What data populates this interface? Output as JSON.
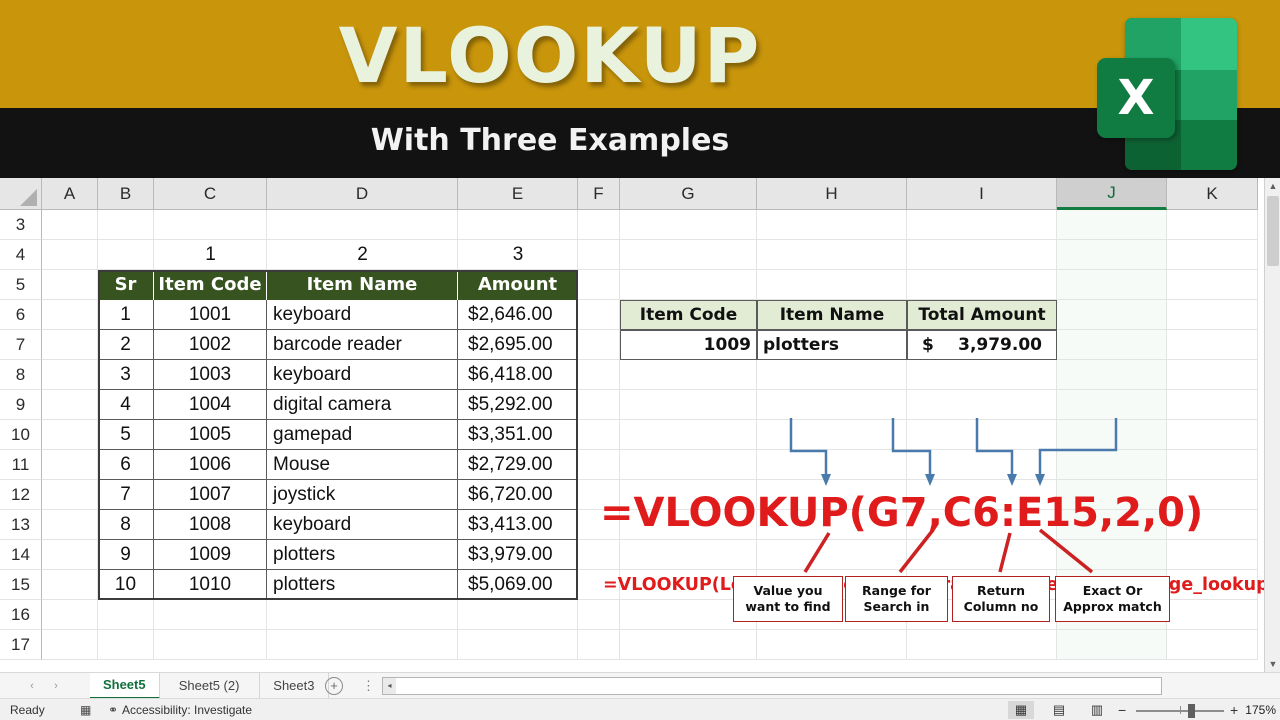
{
  "banner": {
    "title": "VLOOKUP",
    "subtitle": "With Three Examples",
    "logo_letter": "X",
    "gold": "#c8950b",
    "black": "#121212"
  },
  "sheet": {
    "columns": [
      "A",
      "B",
      "C",
      "D",
      "E",
      "F",
      "G",
      "H",
      "I",
      "J",
      "K"
    ],
    "selected_column": "J",
    "rows": [
      "3",
      "4",
      "5",
      "6",
      "7",
      "8",
      "9",
      "10",
      "11",
      "12",
      "13",
      "14",
      "15",
      "16",
      "17"
    ]
  },
  "data_table": {
    "col_index_labels": [
      "1",
      "2",
      "3"
    ],
    "headers": [
      "Sr",
      "Item Code",
      "Item Name",
      "Amount"
    ],
    "header_bg": "#37531f",
    "rows": [
      [
        "1",
        "1001",
        "keyboard",
        "$2,646.00"
      ],
      [
        "2",
        "1002",
        "barcode reader",
        "$2,695.00"
      ],
      [
        "3",
        "1003",
        "keyboard",
        "$6,418.00"
      ],
      [
        "4",
        "1004",
        "digital camera",
        "$5,292.00"
      ],
      [
        "5",
        "1005",
        "gamepad",
        "$3,351.00"
      ],
      [
        "6",
        "1006",
        "Mouse",
        "$2,729.00"
      ],
      [
        "7",
        "1007",
        "joystick",
        "$6,720.00"
      ],
      [
        "8",
        "1008",
        "keyboard",
        "$3,413.00"
      ],
      [
        "9",
        "1009",
        "plotters",
        "$3,979.00"
      ],
      [
        "10",
        "1010",
        "plotters",
        "$5,069.00"
      ]
    ]
  },
  "result_table": {
    "headers": [
      "Item Code",
      "Item Name",
      "Total Amount"
    ],
    "header_bg": "#e2ecd4",
    "item_code": "1009",
    "item_name": "plotters",
    "currency": "$",
    "total_amount": "3,979.00"
  },
  "annotation": {
    "syntax": "=VLOOKUP(Lookup_Value,table_array,col_index_num,[range_lookup]",
    "formula": "=VLOOKUP(G7,C6:E15,2,0)",
    "callouts": [
      {
        "line1": "Value you",
        "line2": "want to find"
      },
      {
        "line1": "Range for",
        "line2": "Search in"
      },
      {
        "line1": "Return",
        "line2": "Column no"
      },
      {
        "line1": "Exact Or",
        "line2": "Approx match"
      }
    ],
    "red": "#e01b1b",
    "blue": "#4a7aab"
  },
  "tabs": {
    "prev_arrow": "‹",
    "next_arrow": "›",
    "items": [
      {
        "label": "Sheet5",
        "active": true
      },
      {
        "label": "Sheet5 (2)",
        "active": false
      },
      {
        "label": "Sheet3",
        "active": false
      }
    ],
    "add_label": "+",
    "dots": "⋮",
    "hscroll_left": "◂"
  },
  "status": {
    "ready": "Ready",
    "accessibility": "Accessibility: Investigate",
    "recording_icon": "record-macro-icon",
    "accessibility_icon": "accessibility-icon",
    "views": [
      {
        "name": "normal-view",
        "glyph": "▦",
        "active": true
      },
      {
        "name": "page-layout-view",
        "glyph": "▤",
        "active": false
      },
      {
        "name": "page-break-view",
        "glyph": "▥",
        "active": false
      }
    ],
    "zoom_out": "−",
    "zoom_in": "+",
    "zoom_value": "175%"
  },
  "scrollbar": {
    "up": "▲",
    "down": "▼"
  }
}
